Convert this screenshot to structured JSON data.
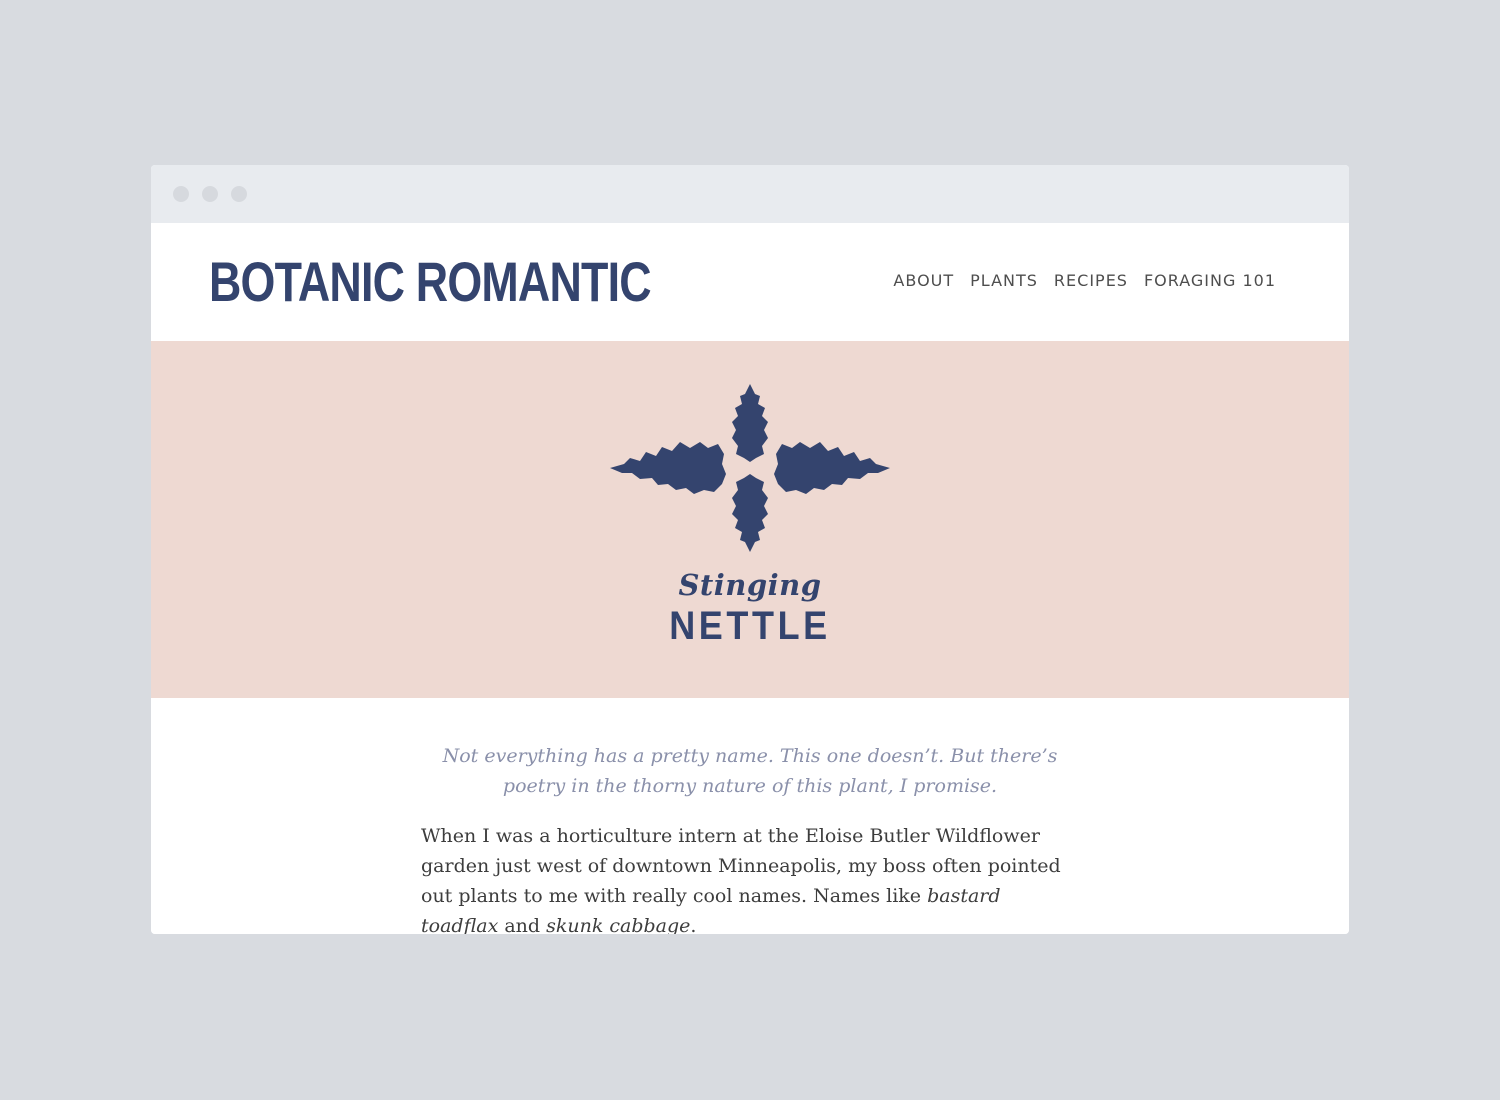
{
  "site": {
    "title": "BOTANIC ROMANTIC"
  },
  "nav": {
    "items": [
      "ABOUT",
      "PLANTS",
      "RECIPES",
      "FORAGING 101"
    ]
  },
  "hero": {
    "script_title": "Stinging",
    "display_title": "NETTLE",
    "emblem_icon": "nettle-leaves-icon",
    "background_color": "#eed9d2",
    "accent_color": "#34446e"
  },
  "article": {
    "intro": "Not everything has a pretty name. This one doesn’t. But there’s poetry in the thorny nature of this plant, I promise.",
    "paragraph_start": "When I was a horticulture intern at the Eloise Butler Wildflower garden just west of downtown Minneapolis, my boss often pointed out plants to me with really cool names. Names like ",
    "emphasis_1": "bastard toadflax",
    "joiner": " and ",
    "emphasis_2": "skunk cabbage",
    "paragraph_end": "."
  }
}
